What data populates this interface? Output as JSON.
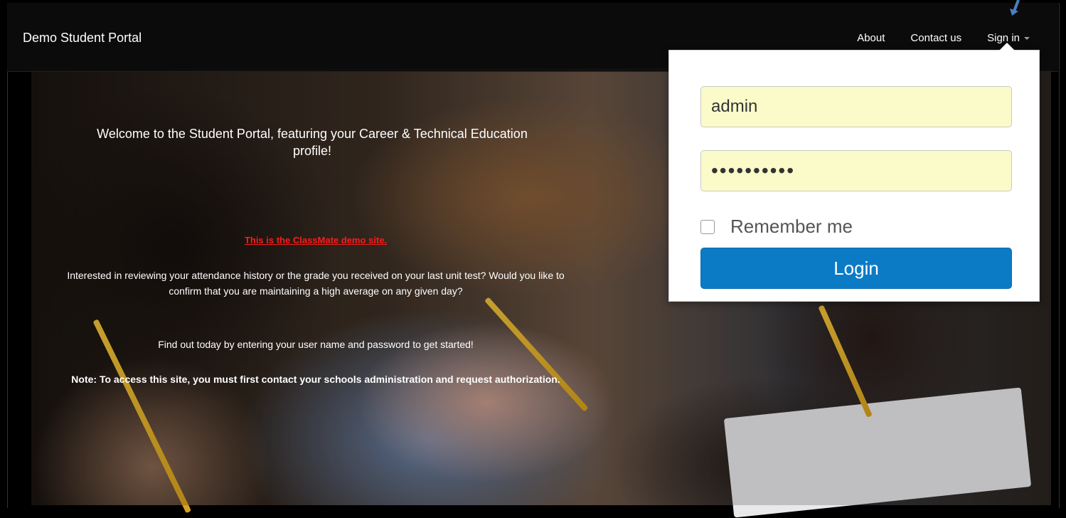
{
  "brand": "Demo Student Portal",
  "nav": {
    "about": "About",
    "contact": "Contact us",
    "signin": "Sign in"
  },
  "welcome": "Welcome to the Student Portal, featuring your Career & Technical Education profile!",
  "demo_notice": "This is the ClassMate demo site.",
  "intro": "Interested in reviewing your attendance history or the grade you received on your last unit test?  Would you like to confirm that you are maintaining a high average on any given day?",
  "findout": "Find out today by entering your user name and password to get started!",
  "note": "Note: To access this site, you must first contact your schools administration and request authorization.",
  "login": {
    "username_value": "admin",
    "password_value": "••••••••••",
    "remember_label": "Remember me",
    "login_button": "Login"
  },
  "colors": {
    "accent": "#0b7bc6",
    "notice_red": "#ff1a1a",
    "field_bg": "#fbfbc9",
    "indicator_arrow": "#4a7fc4"
  },
  "icons": {
    "dropdown": "caret-down-icon",
    "indicator": "arrow-down-icon"
  }
}
